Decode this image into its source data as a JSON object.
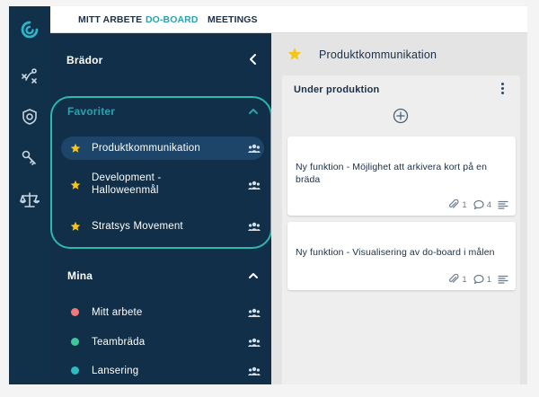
{
  "app": {
    "colors": {
      "rail": "#11304a",
      "sidebar": "#112f48",
      "accent": "#2ba1ad",
      "highlight": "#2cb7b0",
      "selected_item": "#1d4469",
      "star": "#f5c518"
    }
  },
  "rail": {
    "icons": [
      "logo-icon",
      "strategy-icon",
      "shield-icon",
      "key-icon",
      "scales-icon"
    ]
  },
  "topnav": {
    "items": [
      {
        "label": "MITT ARBETE",
        "active": false
      },
      {
        "label": "DO-BOARD",
        "active": true
      },
      {
        "label": "MEETINGS",
        "active": false
      }
    ]
  },
  "sidebar": {
    "title": "Brädor",
    "favorites": {
      "heading": "Favoriter",
      "items": [
        {
          "label": "Produktkommunikation",
          "icon": "star-icon",
          "selected": true
        },
        {
          "label_line1": "Development -",
          "label_line2": "Halloweenmål",
          "icon": "star-icon",
          "selected": false
        },
        {
          "label": "Stratsys Movement",
          "icon": "star-icon",
          "selected": false
        }
      ]
    },
    "mine": {
      "heading": "Mina",
      "items": [
        {
          "label": "Mitt arbete",
          "color": "#f07a7a"
        },
        {
          "label": "Teambräda",
          "color": "#3ec79a"
        },
        {
          "label": "Lansering",
          "color": "#2bbcc0"
        }
      ]
    }
  },
  "board": {
    "title": "Produktkommunikation",
    "column": {
      "title": "Under produktion",
      "cards": [
        {
          "text": "Ny funktion - Möjlighet att arkivera kort på en bräda",
          "attachments": "1",
          "comments": "4"
        },
        {
          "text": "Ny funktion - Visualisering av do-board i målen",
          "attachments": "1",
          "comments": "1"
        }
      ]
    }
  }
}
